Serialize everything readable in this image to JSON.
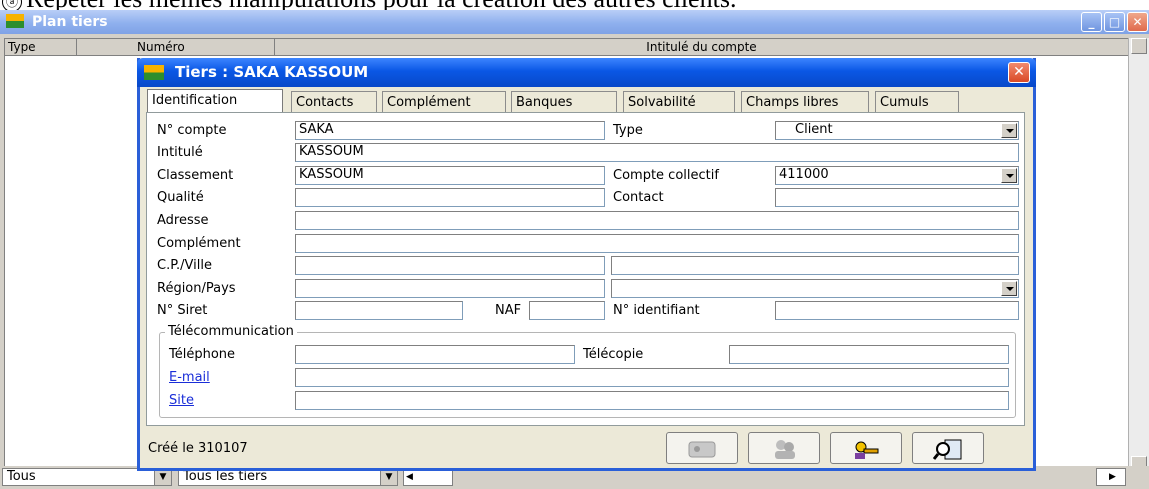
{
  "caption": {
    "number": "ⓐ",
    "text": "Répéter les mêmes manipulations pour la création des autres clients."
  },
  "outer_window": {
    "title": "Plan tiers",
    "columns": [
      "Type",
      "Numéro",
      "Intitulé du compte"
    ],
    "bottom": {
      "filter1": "Tous",
      "filter2": "Tous les tiers"
    },
    "buttons": {
      "minimize": "_",
      "maximize": "□",
      "close": "✕"
    }
  },
  "dialog": {
    "title": "Tiers : SAKA KASSOUM",
    "close": "✕",
    "tabs": [
      "Identification",
      "Contacts",
      "Complément",
      "Banques",
      "Solvabilité",
      "Champs libres",
      "Cumuls"
    ],
    "active_tab": "Identification",
    "fields": {
      "numero_compte": {
        "label": "N° compte",
        "value": "SAKA"
      },
      "type": {
        "label": "Type",
        "value": "Client"
      },
      "intitule": {
        "label": "Intitulé",
        "value": "KASSOUM"
      },
      "classement": {
        "label": "Classement",
        "value": "KASSOUM"
      },
      "compte_collectif": {
        "label": "Compte collectif",
        "value": "411000"
      },
      "qualite": {
        "label": "Qualité",
        "value": ""
      },
      "contact": {
        "label": "Contact",
        "value": ""
      },
      "adresse": {
        "label": "Adresse",
        "value": ""
      },
      "complement": {
        "label": "Complément",
        "value": ""
      },
      "cp_ville": {
        "label": "C.P./Ville",
        "value": ""
      },
      "region_pays": {
        "label": "Région/Pays",
        "value": ""
      },
      "siret": {
        "label": "N° Siret",
        "value": ""
      },
      "naf": {
        "label": "NAF",
        "value": ""
      },
      "identifiant": {
        "label": "N° identifiant",
        "value": ""
      }
    },
    "telecom": {
      "title": "Télécommunication",
      "telephone": {
        "label": "Téléphone",
        "value": ""
      },
      "telecopie": {
        "label": "Télécopie",
        "value": ""
      },
      "email": {
        "label": "E-mail",
        "value": ""
      },
      "site": {
        "label": "Site",
        "value": ""
      }
    },
    "footer": {
      "created": "Créé le 310107"
    },
    "toolbar_icons": [
      "card-icon",
      "people-icon",
      "keys-icon",
      "search-card-icon"
    ]
  },
  "colors": {
    "dialog_title": "#0a57e5",
    "outer_title": "#8fb0ee",
    "link": "#1a2ed8"
  }
}
